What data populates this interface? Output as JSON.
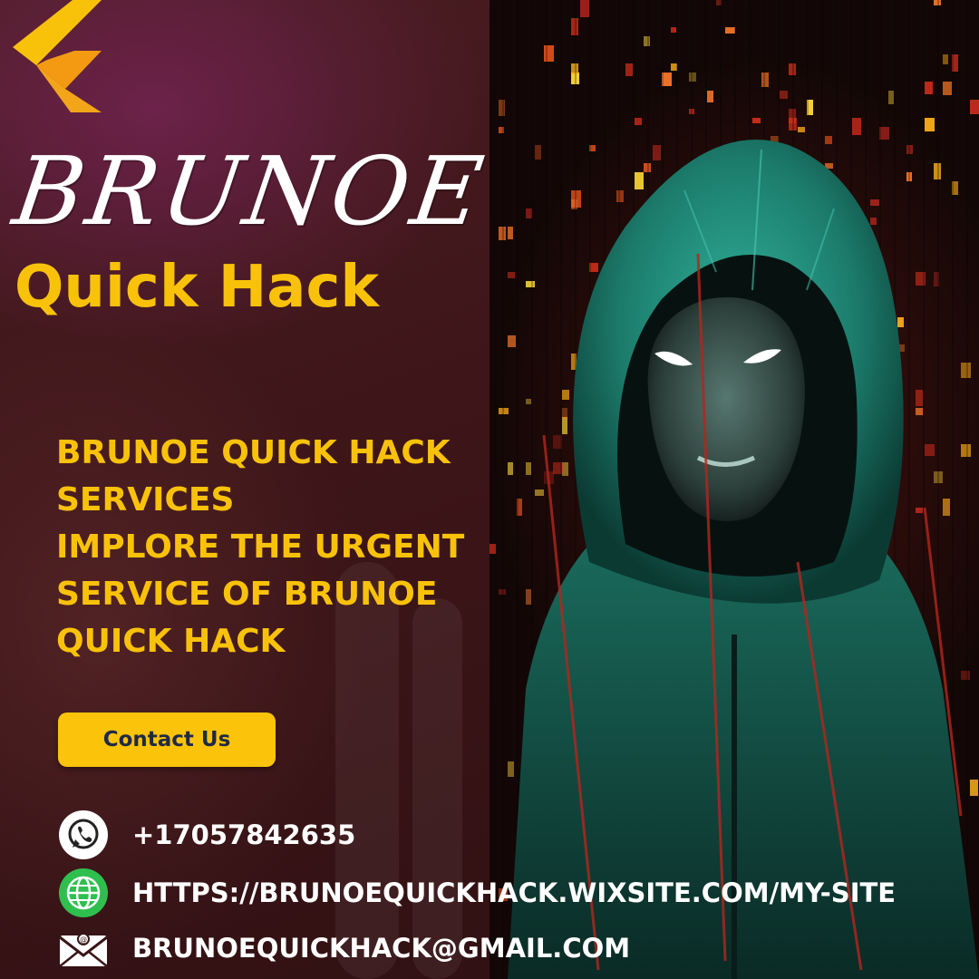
{
  "brand": {
    "script_name": "BRUNOE",
    "subtitle": "Quick Hack"
  },
  "headline": {
    "lines": [
      "BRUNOE QUICK HACK",
      "SERVICES",
      "IMPLORE THE URGENT",
      "SERVICE OF BRUNOE",
      "QUICK HACK"
    ]
  },
  "cta": {
    "label": "Contact Us"
  },
  "contacts": {
    "phone": {
      "icon": "whatsapp-icon",
      "text": "+17057842635"
    },
    "website": {
      "icon": "globe-icon",
      "text": "HTTPS://BRUNOEQUICKHACK.WIXSITE.COM/MY-SITE"
    },
    "email": {
      "icon": "email-icon",
      "text": "BRUNOEQUICKHACK@GMAIL.COM"
    }
  },
  "colors": {
    "accent_yellow": "#f9c20a",
    "button_text": "#1f2a44",
    "background": "#3a1517",
    "hood_teal": "#1f8f7c",
    "whatsapp_green": "#2fbf4f"
  }
}
